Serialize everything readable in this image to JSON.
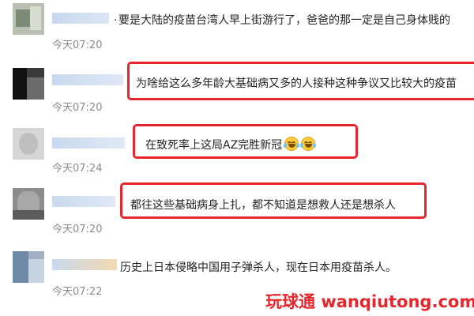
{
  "comments": [
    {
      "text": "要是大陆的疫苗台湾人早上街游行了，爸爸的那一定是自己身体贱的",
      "prefix": ".",
      "time": "今天07:20",
      "highlighted": false
    },
    {
      "text": "为啥给这么多年龄大基础病又多的人接种这种争议又比较大的疫苗",
      "time": "今天07:20",
      "highlighted": true
    },
    {
      "text": "在致死率上这局AZ完胜新冠",
      "emoji": [
        "laugh-cry-emoji",
        "laugh-cry-emoji"
      ],
      "time": "今天07:24",
      "highlighted": true
    },
    {
      "text": "都往这些基础病身上扎，都不知道是想救人还是想杀人",
      "time": "今天07:20",
      "highlighted": true
    },
    {
      "text": "历史上日本侵略中国用子弹杀人，现在日本用疫苗杀人。",
      "time": "今天07:22",
      "highlighted": false
    }
  ],
  "watermark": {
    "cn": "玩球通",
    "en": "wanqiutong.com"
  },
  "colors": {
    "highlight": "#e5262d",
    "time": "#8a8a8a",
    "nickname_blur": "#c9d9ee"
  }
}
